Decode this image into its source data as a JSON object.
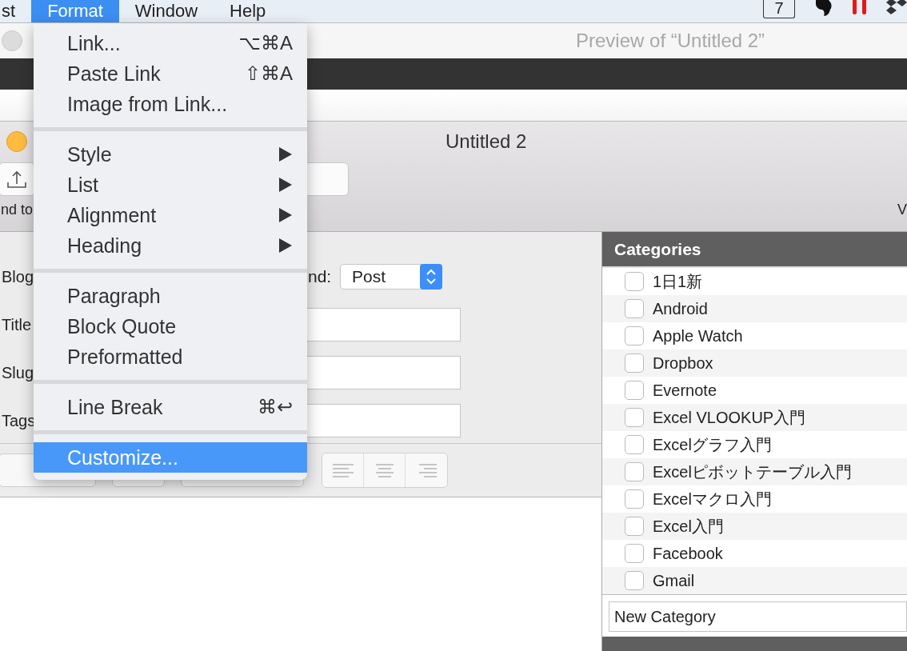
{
  "menubar": {
    "items": [
      {
        "label": "st",
        "selected": false
      },
      {
        "label": "Format",
        "selected": true
      },
      {
        "label": "Window",
        "selected": false
      },
      {
        "label": "Help",
        "selected": false
      }
    ],
    "status_badge": "7"
  },
  "preview_window": {
    "title": "Preview of “Untitled 2”"
  },
  "editor_window": {
    "title": "Untitled 2",
    "toolbar_label": "nd to",
    "toolbar_label_right": "V"
  },
  "form": {
    "blog_label": "Blog",
    "kind_label": "nd:",
    "kind_value": "Post",
    "fields": [
      {
        "label": "Title"
      },
      {
        "label": "Slug"
      },
      {
        "label": "Tags"
      }
    ]
  },
  "categories": {
    "title": "Categories",
    "items": [
      {
        "label": "1日1新",
        "checked": false
      },
      {
        "label": "Android",
        "checked": false
      },
      {
        "label": "Apple Watch",
        "checked": false
      },
      {
        "label": "Dropbox",
        "checked": false
      },
      {
        "label": "Evernote",
        "checked": false
      },
      {
        "label": "Excel VLOOKUP入門",
        "checked": false
      },
      {
        "label": "Excelグラフ入門",
        "checked": false
      },
      {
        "label": "Excelピボットテーブル入門",
        "checked": false
      },
      {
        "label": "Excelマクロ入門",
        "checked": false
      },
      {
        "label": "Excel入門",
        "checked": false
      },
      {
        "label": "Facebook",
        "checked": false
      },
      {
        "label": "Gmail",
        "checked": false
      }
    ],
    "new_category": {
      "placeholder": "New Category"
    }
  },
  "format_menu": {
    "sections": [
      {
        "items": [
          {
            "label": "Link...",
            "shortcut": "⌥⌘A",
            "submenu": false,
            "selected": false
          },
          {
            "label": "Paste Link",
            "shortcut": "⇧⌘A",
            "submenu": false,
            "selected": false
          },
          {
            "label": "Image from Link...",
            "submenu": false,
            "selected": false
          }
        ]
      },
      {
        "items": [
          {
            "label": "Style",
            "submenu": true,
            "selected": false
          },
          {
            "label": "List",
            "submenu": true,
            "selected": false
          },
          {
            "label": "Alignment",
            "submenu": true,
            "selected": false
          },
          {
            "label": "Heading",
            "submenu": true,
            "selected": false
          }
        ]
      },
      {
        "items": [
          {
            "label": "Paragraph",
            "submenu": false,
            "selected": false
          },
          {
            "label": "Block Quote",
            "submenu": false,
            "selected": false
          },
          {
            "label": "Preformatted",
            "submenu": false,
            "selected": false
          }
        ]
      },
      {
        "items": [
          {
            "label": "Line Break",
            "shortcut": "⌘↩",
            "submenu": false,
            "selected": false
          }
        ]
      },
      {
        "items": [
          {
            "label": "Customize...",
            "submenu": false,
            "selected": true
          }
        ]
      }
    ]
  }
}
